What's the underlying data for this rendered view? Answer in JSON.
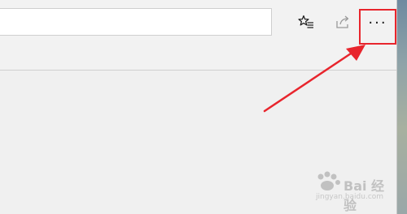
{
  "browser": {
    "address_bar": {
      "value": ""
    },
    "toolbar": {
      "favorites_icon": "star-list-icon",
      "share_icon": "share-icon",
      "more_label": "···"
    }
  },
  "annotation": {
    "highlight_color": "#e8252d",
    "arrow_color": "#e8252d"
  },
  "watermark": {
    "text": "Bai 经验",
    "url": "jingyan.baidu.com"
  }
}
